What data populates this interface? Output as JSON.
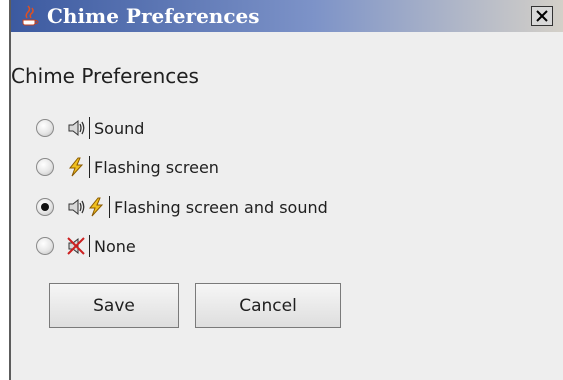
{
  "window": {
    "title": "Chime Preferences",
    "close_label": "X"
  },
  "content": {
    "heading": "Chime Preferences"
  },
  "options": [
    {
      "label": "Sound",
      "checked": false,
      "icons": [
        "speaker-icon"
      ]
    },
    {
      "label": "Flashing screen",
      "checked": false,
      "icons": [
        "lightning-icon"
      ]
    },
    {
      "label": "Flashing screen and sound",
      "checked": true,
      "icons": [
        "speaker-icon",
        "lightning-icon"
      ]
    },
    {
      "label": "None",
      "checked": false,
      "icons": [
        "muted-speaker-icon"
      ]
    }
  ],
  "buttons": {
    "save": "Save",
    "cancel": "Cancel"
  },
  "colors": {
    "titlebar_start": "#3c5aa0",
    "window_bg": "#eeeeee",
    "lightning": "#f0c020"
  }
}
